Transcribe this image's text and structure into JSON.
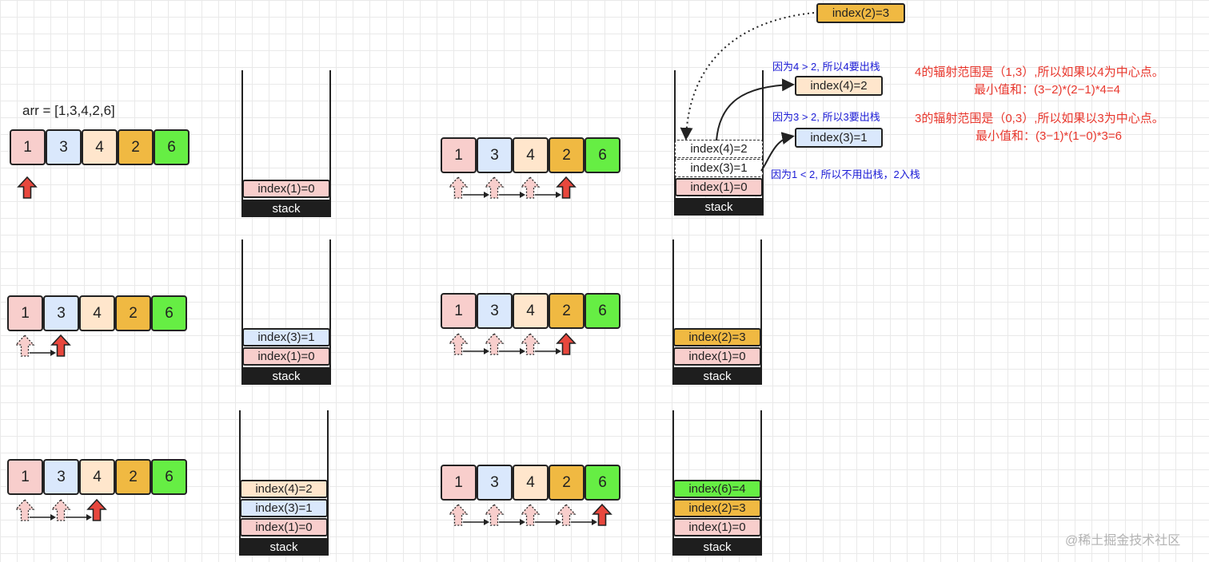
{
  "colors": {
    "pink": "#f8cecc",
    "blue": "#dae8fc",
    "peach": "#ffe6cc",
    "orange": "#f0b942",
    "green": "#66ee44",
    "pointer_red": "#e8473d",
    "pointer_ghost": "#f8cecc",
    "base": "#1e1e1e",
    "blue_text": "#1b1bd6",
    "red_text": "#e8372d"
  },
  "array_label": "arr  = [1,3,4,2,6]",
  "array_values": [
    "1",
    "3",
    "4",
    "2",
    "6"
  ],
  "array_colors": [
    "pink",
    "blue",
    "peach",
    "orange",
    "green"
  ],
  "stack_label": "stack",
  "steps": [
    {
      "id": "step1",
      "pointer": 0,
      "stack": [
        {
          "text": "index(1)=0",
          "color": "pink"
        }
      ]
    },
    {
      "id": "step2",
      "pointer": 1,
      "stack": [
        {
          "text": "index(3)=1",
          "color": "blue"
        },
        {
          "text": "index(1)=0",
          "color": "pink"
        }
      ]
    },
    {
      "id": "step3",
      "pointer": 2,
      "stack": [
        {
          "text": "index(4)=2",
          "color": "peach"
        },
        {
          "text": "index(3)=1",
          "color": "blue"
        },
        {
          "text": "index(1)=0",
          "color": "pink"
        }
      ]
    },
    {
      "id": "step4",
      "pointer": 3,
      "stack": [
        {
          "text": "index(4)=2",
          "color": "white"
        },
        {
          "text": "index(3)=1",
          "color": "white"
        },
        {
          "text": "index(1)=0",
          "color": "pink"
        }
      ]
    },
    {
      "id": "step5",
      "pointer": 3,
      "stack": [
        {
          "text": "index(2)=3",
          "color": "orange"
        },
        {
          "text": "index(1)=0",
          "color": "pink"
        }
      ]
    },
    {
      "id": "step6",
      "pointer": 4,
      "stack": [
        {
          "text": "index(6)=4",
          "color": "green"
        },
        {
          "text": "index(2)=3",
          "color": "orange"
        },
        {
          "text": "index(1)=0",
          "color": "pink"
        }
      ]
    }
  ],
  "popped": [
    {
      "text": "index(4)=2",
      "color": "peach"
    },
    {
      "text": "index(3)=1",
      "color": "blue"
    }
  ],
  "pushed": {
    "text": "index(2)=3",
    "color": "orange"
  },
  "notes": {
    "pop4": "因为4 > 2, 所以4要出栈",
    "pop3": "因为3 > 2, 所以3要出栈",
    "push2": "因为1 < 2, 所以不用出栈，2入栈",
    "range4_line1": "4的辐射范围是（1,3）,所以如果以4为中心点。",
    "range4_line2": "最小值和：(3−2)*(2−1)*4=4",
    "range3_line1": "3的辐射范围是（0,3）,所以如果以3为中心点。",
    "range3_line2": "最小值和：(3−1)*(1−0)*3=6"
  },
  "watermark": "@稀土掘金技术社区"
}
